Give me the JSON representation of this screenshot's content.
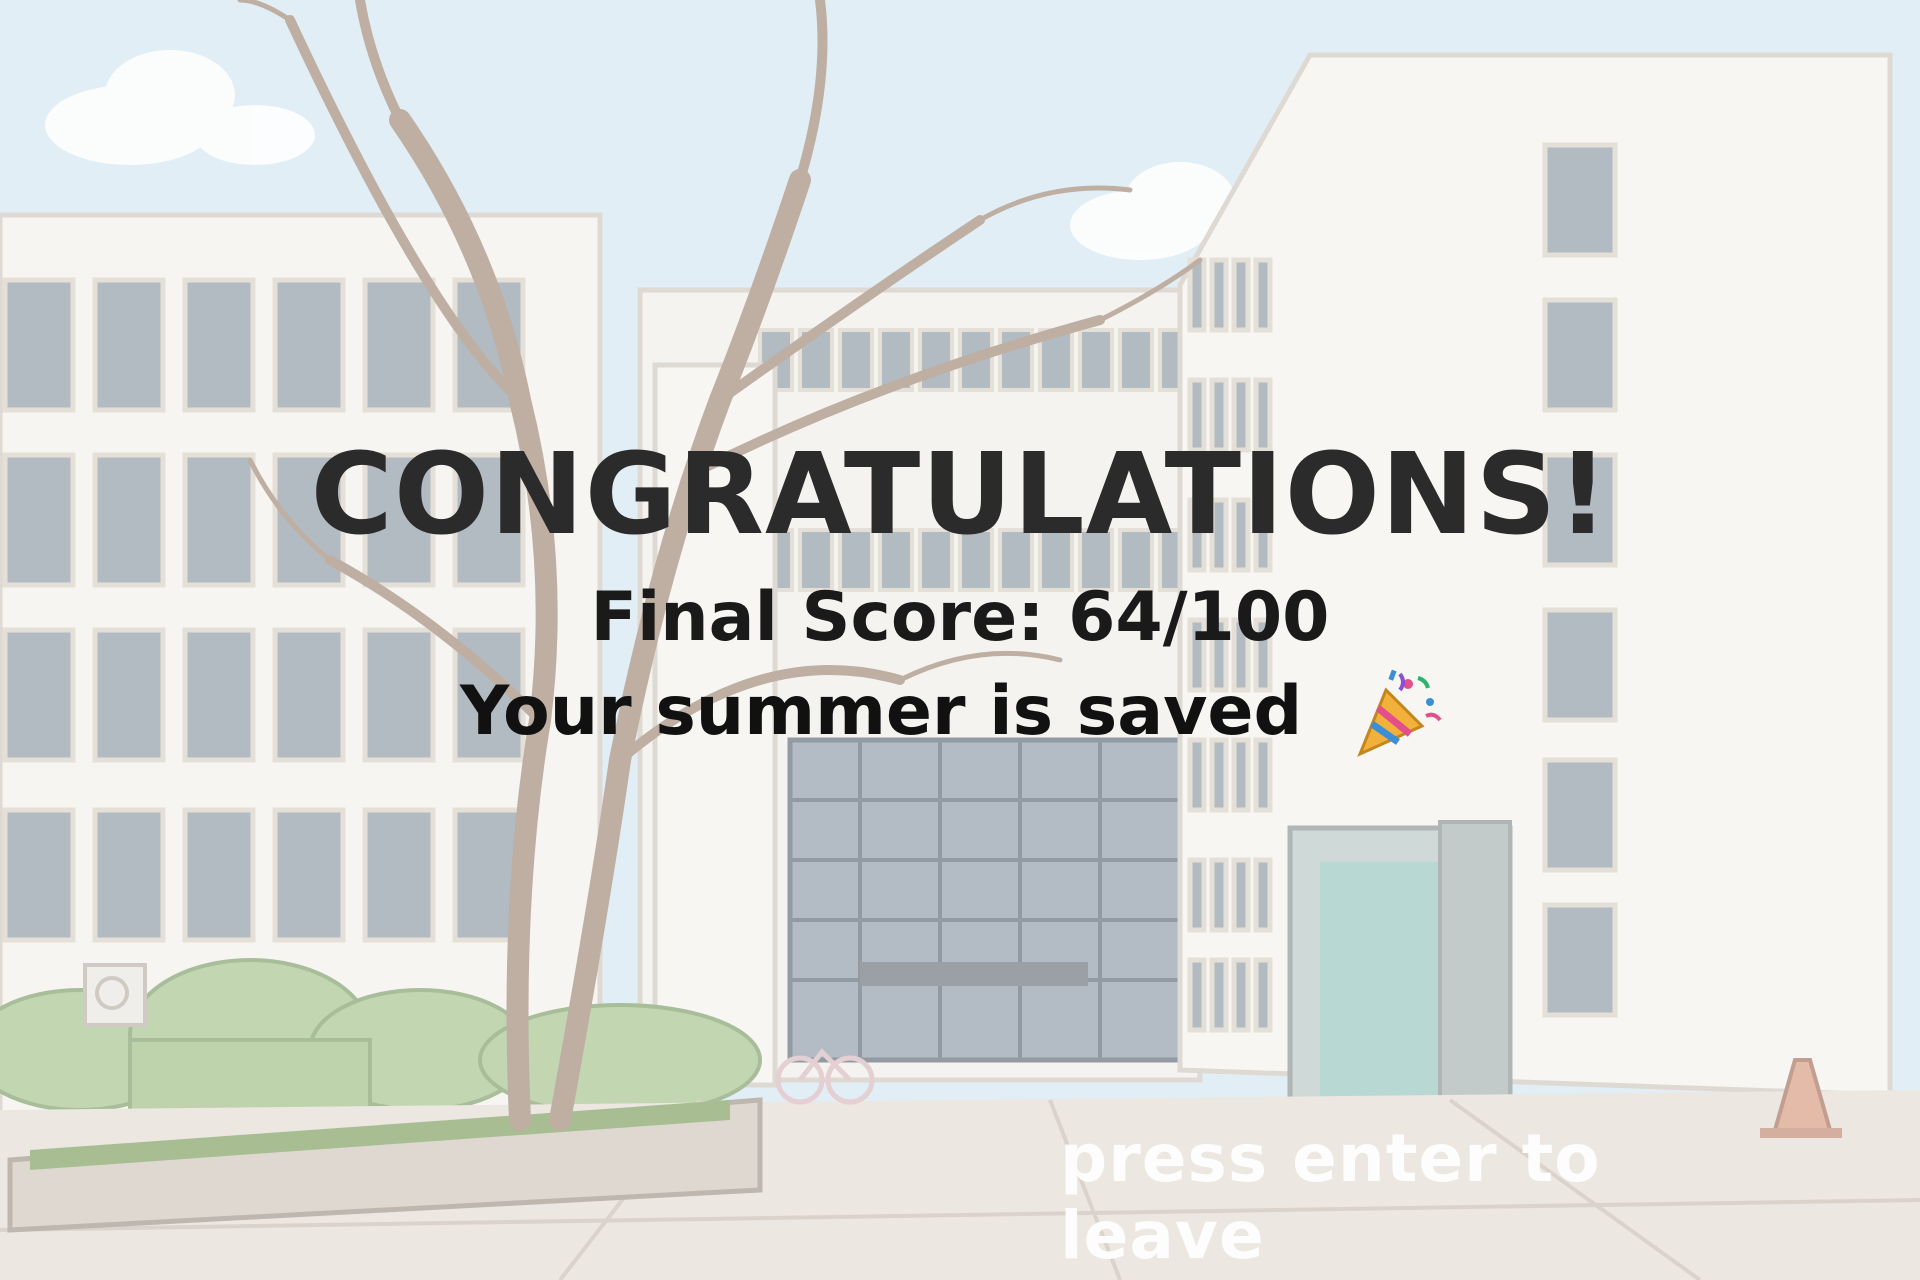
{
  "end_screen": {
    "title": "CONGRATULATIONS!",
    "score_line": "Final Score: 64/100",
    "message": "Your summer is saved",
    "message_icon": "party-popper-icon",
    "prompt": "press enter to leave"
  },
  "score": {
    "value": 64,
    "max": 100
  },
  "colors": {
    "sky": "#d4e6f1",
    "building": "#f2f1ec",
    "window": "#9aa6b2",
    "title": "#2b2b2b",
    "prompt": "#ffffff"
  }
}
